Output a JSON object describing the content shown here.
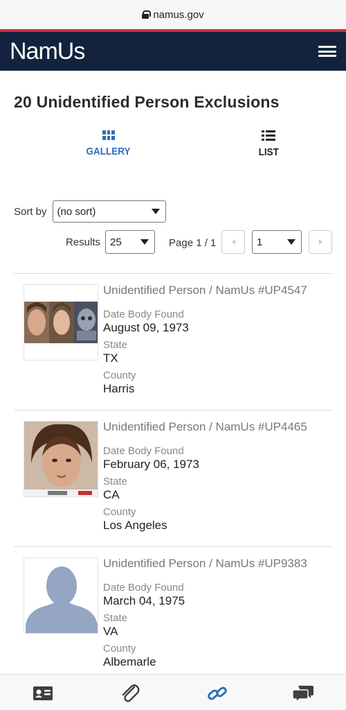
{
  "browser": {
    "url": "namus.gov"
  },
  "nav": {
    "logo": "NamUs"
  },
  "page": {
    "title": "20 Unidentified Person Exclusions"
  },
  "view_toggle": {
    "gallery_label": "GALLERY",
    "list_label": "LIST",
    "active": "gallery"
  },
  "sort": {
    "label": "Sort by",
    "value": "(no sort)"
  },
  "paging": {
    "results_label": "Results",
    "results_value": "25",
    "page_label": "Page 1 / 1",
    "page_value": "1"
  },
  "cases": [
    {
      "title": "Unidentified Person / NamUs #UP4547",
      "date_label": "Date Body Found",
      "date": "August 09, 1973",
      "state_label": "State",
      "state": "TX",
      "county_label": "County",
      "county": "Harris"
    },
    {
      "title": "Unidentified Person / NamUs #UP4465",
      "date_label": "Date Body Found",
      "date": "February 06, 1973",
      "state_label": "State",
      "state": "CA",
      "county_label": "County",
      "county": "Los Angeles"
    },
    {
      "title": "Unidentified Person / NamUs #UP9383",
      "date_label": "Date Body Found",
      "date": "March 04, 1975",
      "state_label": "State",
      "state": "VA",
      "county_label": "County",
      "county": "Albemarle"
    }
  ],
  "bottom_tabs": [
    "id-card-icon",
    "paperclip-icon",
    "link-icon",
    "chat-icon"
  ],
  "colors": {
    "navbar": "#13233d",
    "accent_red": "#c8323c",
    "active_blue": "#2f6fba"
  }
}
